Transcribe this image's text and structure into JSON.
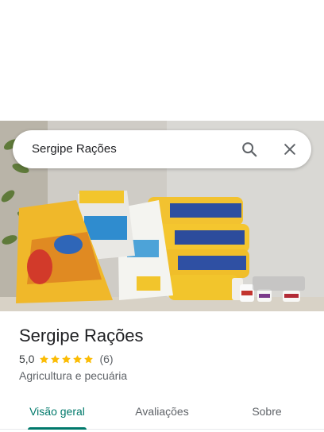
{
  "search": {
    "query": "Sergipe Rações"
  },
  "icons": {
    "search": "search-icon",
    "close": "close-icon"
  },
  "place": {
    "name": "Sergipe Rações",
    "rating": "5,0",
    "stars": 5,
    "review_count": "(6)",
    "category": "Agricultura e pecuária"
  },
  "tabs": [
    {
      "label": "Visão geral",
      "active": true
    },
    {
      "label": "Avaliações",
      "active": false
    },
    {
      "label": "Sobre",
      "active": false
    }
  ],
  "colors": {
    "accent": "#00796b",
    "star": "#fbbc04",
    "text_primary": "#202124",
    "text_secondary": "#5f6368"
  }
}
